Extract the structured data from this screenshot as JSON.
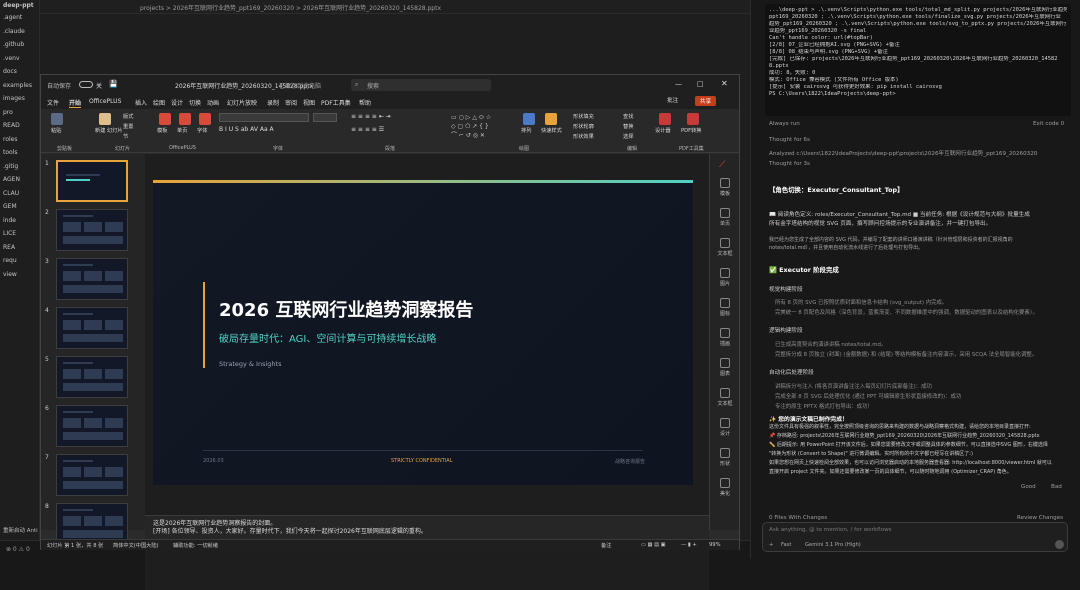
{
  "ide": {
    "top_path": "projects > 2026年互联网行业趋势_ppt169_20260320 > 2026年互联网行业趋势_20260320_145828.pptx",
    "tree": [
      ".agent",
      ".claude",
      ".github",
      ".venv",
      "docs",
      "examples",
      "images",
      "pro",
      "READ",
      "roles",
      "tools",
      ".gitig",
      "AGEN",
      "CLAU",
      "GEM",
      "inde",
      "LICE",
      "REA",
      "requ",
      "view"
    ],
    "title_root": "deep-ppt",
    "bottom_left": "重新启动 Anti",
    "status_left": "⊗ 0  ⚠ 0"
  },
  "terminal": {
    "lines": [
      "...\\deep-ppt > .\\.venv\\Scripts\\python.exe tools/total_md_split.py projects/2026年互联网行业趋势_",
      "ppt169_20260320 ; .\\.venv\\Scripts\\python.exe tools/finalize_svg.py projects/2026年互联网行业",
      "趋势_ppt169_20260320 ; .\\.venv\\Scripts\\python.exe tools/svg_to_pptx.py projects/2026年互联网行",
      "业趋势_ppt169_20260320 -s final",
      "   Can't handle color: url(#topBar)",
      "   [2/8] 07_企业已经拥抱AI.svg (PNG+SVG) +备注",
      "   [8/8] 08_结束与声明.svg (PNG+SVG) +备注",
      "",
      "   [完成] 已保存: projects\\2026年互联网行业趋势_ppt169_20260320\\2026年互联网行业趋势_20260320_14582",
      "8.pptx",
      "   成功: 8，失败: 0",
      "   模式: Office 兼容模式 (文件所有 Office 版本)",
      "   [提示] 安装 cairosvg 可获得更好效果: pip install cairosvg",
      "PS C:\\Users\\1822\\IdeaProjects\\deep-ppt>"
    ],
    "always_run": "Always run",
    "exit_code": "Exit code 0"
  },
  "chat": {
    "thought1": "Thought for 6s",
    "analyzed": "Analyzed  c:\\Users\\1822\\IdeaProjects\\deep-ppt\\projects\\2026年互联网行业趋势_ppt169_20260320",
    "thought2": "Thought for 3s",
    "role_heading": "【角色切换：Executor_Consultant_Top】",
    "role_line1": "📖 阅读角色定义: roles/Executor_Consultant_Top.md  ■ 当前任务: 根据《设计规范与大纲》批量生成",
    "role_line2": "所有金字塔结构的视觉 SVG 页面，撰写顾问控场提示的专业演讲备注，并一键打包导出。",
    "role_line3": "我已经为您生成了全部内容的 SVG 代码，并编写了配套的讲师口播演讲稿（针对管理层和投资者的汇报视角的",
    "role_line4": "notes/total.md），并且使用自动化流水线进行了后处理与打包导出。",
    "exec_done": "✅ Executor 阶段完成",
    "visual_title": "视觉构建阶段",
    "visual_items": [
      "所有 8 页的 SVG 已按照优质封面和信息卡结构 (svg_output) 内完成。",
      "完美统一 8 页配色及风格（深色背景，蓝紫渐变、不同数据维度中的强调、数据驱动的图表以及结构化要素）。"
    ],
    "logic_title": "逻辑构建阶段",
    "logic_items": [
      "已生成高度契合的演讲讲稿 notes/total.md。",
      "完整拆分成 8 页独立 (封面) (金额数据) 和 (结尾) 等结构模板备注内容演示，采用 SCQA 法全局智能化调整。"
    ],
    "auto_title": "自动化后处理阶段",
    "auto_items": [
      "讲稿拆分与注入 (将各页演讲备注注入每页幻灯片底部备注)：成功",
      "完成全部 8 页 SVG 后处理优化 (通过 PPT 可编辑原生形状直接修改的)：成功",
      "专注的原生 PPTX 格式打包导出：成功！"
    ],
    "file_ready": "✨ 您的演示文稿已制作完成！",
    "file_desc1": "这份文件具有极强的叙事性，完全按照顶级咨询的思路来构建的数据与战略洞察格式构建，请给您的本地目录直接打开:",
    "file_desc2": "📌 存档路径: projects\\2026年互联网行业趋势_ppt169_20260320\\2026年互联网行业趋势_20260320_145828.pptx",
    "file_desc3": "✏️ 后期提示: 用 PowerPoint 打开该文件后，如果您需要修改文字或调整具体的参数细节，可以直接选中SVG 图形，右键选择",
    "file_desc4": "\"转换为形状 (Convert to Shape)\" 进行微调编辑。实时所有的中文字都已经写在讲稿区了:)",
    "file_desc5": "如果您想在网页上快速检阅全部效果，也可以访问浏览器启动的本地服务器查看器: http://localhost:8000/viewer.html 就可以",
    "file_desc6": "直接开启 project 文件夹。如果还需要修改某一页的具体细节，可以随时随地调用 (Optimizer_CRAP) 角色。",
    "good": "Good",
    "bad": "Bad",
    "files_changed": "0 Files With Changes",
    "review": "Review Changes",
    "input_placeholder": "Ask anything, @ to mention, / for workflows",
    "mode": "Fast",
    "model": "Gemini 3.1 Pro (High)"
  },
  "ppt": {
    "autosave": "自动保存",
    "autosave_state": "关",
    "doc_title": "2026年互联网行业趋势_20260320_145828.pptx",
    "saved": "已保存到此电脑",
    "search": "搜索",
    "menu": [
      "文件",
      "开始",
      "OfficePLUS",
      "插入",
      "绘图",
      "设计",
      "切换",
      "动画",
      "幻灯片放映",
      "录制",
      "审阅",
      "视图",
      "PDF工具集",
      "帮助"
    ],
    "comment": "批注",
    "share": "共享",
    "ribbon": {
      "paste": "粘贴",
      "new_slide": "新建\n幻灯片",
      "layout": "版式",
      "reset": "重置",
      "section": "节",
      "theme": "模板",
      "single_page": "单页",
      "font_btn": "字体",
      "find": "查找",
      "replace": "替换",
      "select": "选择",
      "draw_shapes": "排列",
      "quick_style": "快速样式",
      "fill": "形状填充",
      "outline": "形状轮廓",
      "effect": "形状效果",
      "designer": "设计器",
      "pdf": "PDF转换",
      "groups": [
        "剪贴板",
        "幻灯片",
        "OfficePLUS",
        "字体",
        "段落",
        "绘图",
        "编辑",
        "PDF工具集"
      ]
    },
    "thumb_numbers": [
      "1",
      "2",
      "3",
      "4",
      "5",
      "6",
      "7",
      "8"
    ],
    "slide": {
      "title": "2026 互联网行业趋势洞察报告",
      "subtitle": "破局存量时代：AGI、空间计算与可持续增长战略",
      "tagline": "Strategy & Insights",
      "footer_left": "2026.03",
      "footer_center": "STRICTLY CONFIDENTIAL",
      "footer_right": "战略咨询报告"
    },
    "panel": [
      "模板",
      "单页",
      "文本框",
      "图片",
      "图标",
      "插画",
      "图表",
      "文本框",
      "设计",
      "形状",
      "美化"
    ],
    "notes_line1": "这是2026年互联网行业趋势洞察报告的封面。",
    "notes_line2": "[开场] 各位领导、投资人，大家好。存量时代下，我们今天将一起探讨2026年互联网底层逻辑的重构。",
    "status": {
      "slide": "幻灯片 第 1 张，共 8 张",
      "lang": "简体中文(中国大陆)",
      "a11y": "辅助功能: 一切就绪",
      "notes": "备注",
      "zoom": "99%"
    }
  }
}
